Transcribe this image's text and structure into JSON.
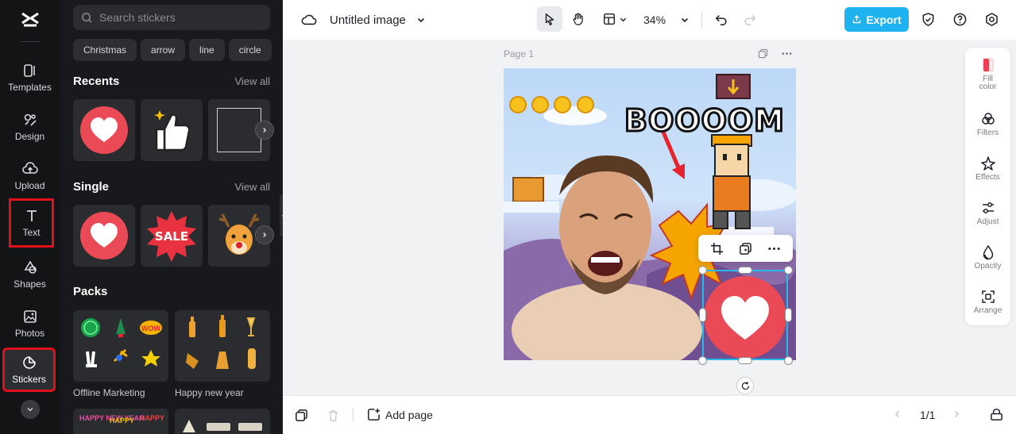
{
  "rail": {
    "items": [
      {
        "label": "Templates"
      },
      {
        "label": "Design"
      },
      {
        "label": "Upload"
      },
      {
        "label": "Text"
      },
      {
        "label": "Shapes"
      },
      {
        "label": "Photos"
      },
      {
        "label": "Stickers"
      }
    ],
    "highlight_color": "#e0101c"
  },
  "panel": {
    "search_placeholder": "Search stickers",
    "chips": [
      "Christmas",
      "arrow",
      "line",
      "circle"
    ],
    "recents": {
      "title": "Recents",
      "view_all": "View all"
    },
    "single": {
      "title": "Single",
      "view_all": "View all",
      "sale_text": "SALE"
    },
    "packs": {
      "title": "Packs",
      "items": [
        {
          "name": "Offline Marketing"
        },
        {
          "name": "Happy new year"
        }
      ],
      "happy_new_year_text": "HAPPY NEW YEAR"
    }
  },
  "topbar": {
    "title": "Untitled image",
    "zoom": "34%",
    "export_label": "Export",
    "accent": "#1eb2f0"
  },
  "canvas": {
    "page_label": "Page 1",
    "boom_text": "BOOOOM",
    "selection_color": "#27b9e8"
  },
  "rtools": [
    {
      "label1": "Fill",
      "label2": "color"
    },
    {
      "label1": "Filters",
      "label2": ""
    },
    {
      "label1": "Effects",
      "label2": ""
    },
    {
      "label1": "Adjust",
      "label2": ""
    },
    {
      "label1": "Opacity",
      "label2": ""
    },
    {
      "label1": "Arrange",
      "label2": ""
    }
  ],
  "bottombar": {
    "add_page_label": "Add page",
    "page_counter": "1/1"
  }
}
